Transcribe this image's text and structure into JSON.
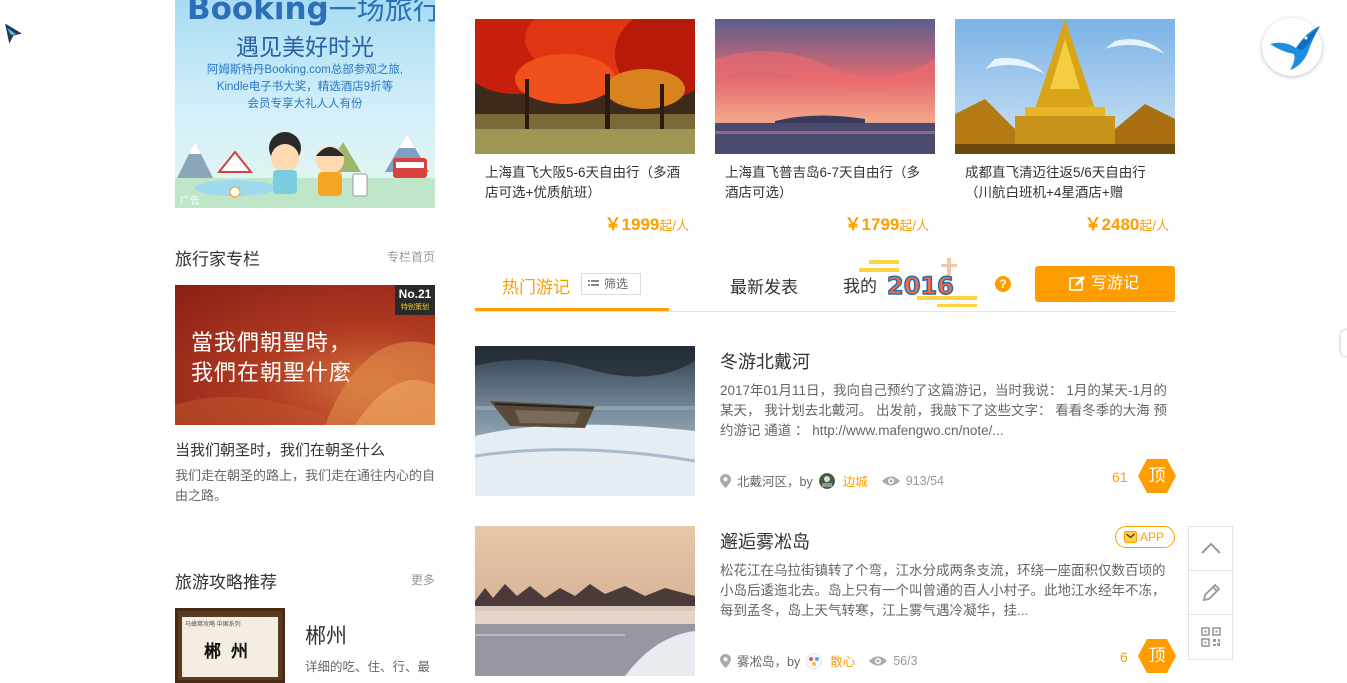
{
  "ad": {
    "brand": "Booking",
    "brand_sub": "一场旅行",
    "headline": "遇见美好时光",
    "desc_lines": [
      "阿姆斯特丹Booking.com总部参观之旅,",
      "Kindle电子书大奖，精选酒店9折等",
      "会员专享大礼人人有份"
    ],
    "tag": "广告"
  },
  "column": {
    "title": "旅行家专栏",
    "link": "专栏首页",
    "banner_line1": "當我們朝聖時，",
    "banner_line2": "我們在朝聖什麼",
    "badge_no": "No.21",
    "badge_sub": "特别策划",
    "article_title": "当我们朝圣时，我们在朝圣什么",
    "article_desc": "我们走在朝圣的路上，我们走在通往内心的自由之路。"
  },
  "guides": {
    "title": "旅游攻略推荐",
    "link": "更多",
    "item": {
      "series": "马蜂窝攻略 中国系列",
      "cover_name": "郴州",
      "title": "郴州",
      "desc": "详细的吃、住、行、最"
    }
  },
  "deals": [
    {
      "title": "上海直飞大阪5-6天自由行（多酒店可选+优质航班）",
      "price": "￥1999",
      "unit": "起/人"
    },
    {
      "title": "上海直飞普吉岛6-7天自由行（多酒店可选）",
      "price": "￥1799",
      "unit": "起/人"
    },
    {
      "title": "成都直飞清迈往返5/6天自由行（川航白班机+4星酒店+赠",
      "price": "￥2480",
      "unit": "起/人"
    }
  ],
  "tabs": {
    "hot": "热门游记",
    "filter": "筛选",
    "new": "最新发表",
    "my": "我的",
    "year": "2016",
    "help": "?",
    "write": "写游记"
  },
  "notes": [
    {
      "title": "冬游北戴河",
      "excerpt": "2017年01月11日，我向自己预约了这篇游记，当时我说： 1月的某天-1月的某天， 我计划去北戴河。 出发前，我敲下了这些文字： 看看冬季的大海 预约游记 通道 ： http://www.mafengwo.cn/note/...",
      "location": "北戴河区",
      "by": "，by",
      "author": "边城",
      "views": "913/54",
      "likes": "61",
      "ding": "顶",
      "app": ""
    },
    {
      "title": "邂逅雾凇岛",
      "excerpt": "松花江在乌拉街镇转了个弯，江水分成两条支流，环绕一座面积仅数百顷的小岛后逶迤北去。岛上只有一个叫曾通的百人小村子。此地江水经年不冻，每到孟冬，岛上天气转寒，江上雾气遇冷凝华，挂...",
      "location": "雾凇岛",
      "by": "，by",
      "author": "散心",
      "views": "56/3",
      "likes": "6",
      "ding": "顶",
      "app": "APP"
    }
  ],
  "colors": {
    "accent": "#ff9d00",
    "text": "#333333",
    "muted": "#999999"
  }
}
